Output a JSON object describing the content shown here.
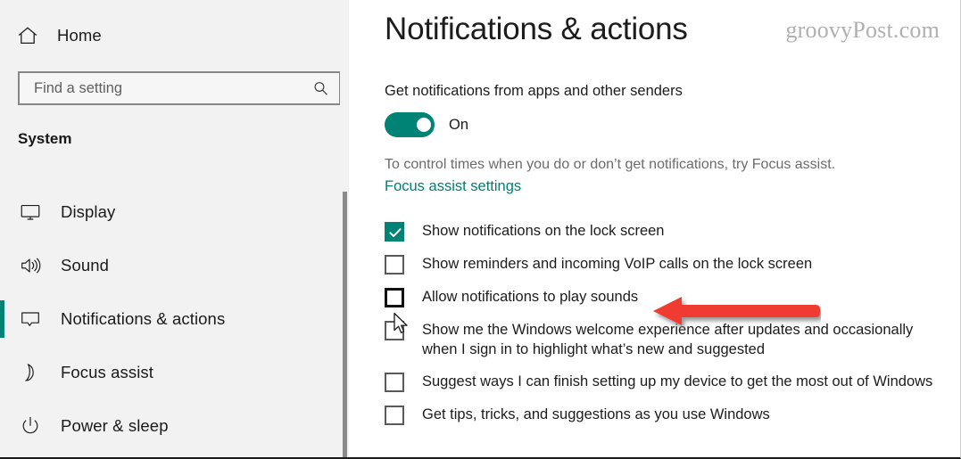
{
  "sidebar": {
    "home": {
      "label": "Home",
      "icon": "home-icon"
    },
    "search": {
      "placeholder": "Find a setting",
      "value": "",
      "icon": "search-icon"
    },
    "group_title": "System",
    "items": [
      {
        "label": "Display",
        "icon": "monitor-icon",
        "selected": false
      },
      {
        "label": "Sound",
        "icon": "speaker-icon",
        "selected": false
      },
      {
        "label": "Notifications & actions",
        "icon": "speech-bubble-icon",
        "selected": true
      },
      {
        "label": "Focus assist",
        "icon": "moon-icon",
        "selected": false
      },
      {
        "label": "Power & sleep",
        "icon": "power-icon",
        "selected": false
      }
    ]
  },
  "main": {
    "title": "Notifications & actions",
    "watermark": "groovyPost.com",
    "section_label": "Get notifications from apps and other senders",
    "toggle": {
      "state_label": "On",
      "on": true
    },
    "hint_text": "To control times when you do or don’t get notifications, try Focus assist.",
    "hint_link": "Focus assist settings",
    "checkboxes": [
      {
        "label": "Show notifications on the lock screen",
        "checked": true,
        "hovered": false
      },
      {
        "label": "Show reminders and incoming VoIP calls on the lock screen",
        "checked": false,
        "hovered": false
      },
      {
        "label": "Allow notifications to play sounds",
        "checked": false,
        "hovered": true
      },
      {
        "label": "Show me the Windows welcome experience after updates and occasionally when I sign in to highlight what’s new and suggested",
        "checked": false,
        "hovered": false
      },
      {
        "label": "Suggest ways I can finish setting up my device to get the most out of Windows",
        "checked": false,
        "hovered": false
      },
      {
        "label": "Get tips, tricks, and suggestions as you use Windows",
        "checked": false,
        "hovered": false
      }
    ]
  },
  "annotations": {
    "arrow": {
      "name": "red-arrow-annotation",
      "color": "#f03a30",
      "direction": "left",
      "points_at": "Allow notifications to play sounds"
    },
    "cursor": {
      "name": "mouse-cursor",
      "color": "#ffffff"
    }
  },
  "colors": {
    "accent": "#008275",
    "sidebar_bg": "#f2f2f2",
    "main_bg": "#ffffff",
    "text": "#1c1c1c",
    "muted_text": "#6b6b6b",
    "annotation_red": "#f03a30"
  }
}
